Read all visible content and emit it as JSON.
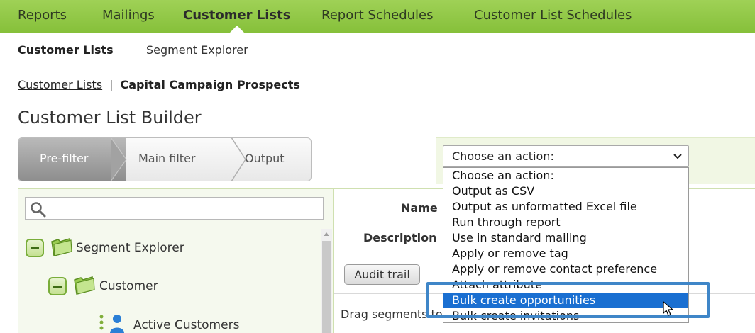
{
  "topnav": {
    "tabs": [
      {
        "label": "Reports"
      },
      {
        "label": "Mailings"
      },
      {
        "label": "Customer Lists"
      },
      {
        "label": "Report Schedules"
      },
      {
        "label": "Customer List Schedules"
      }
    ],
    "active_tab": "Customer Lists"
  },
  "subnav": {
    "items": [
      {
        "label": "Customer Lists"
      },
      {
        "label": "Segment Explorer"
      }
    ],
    "active_item": "Customer Lists"
  },
  "breadcrumb": {
    "link": "Customer Lists",
    "separator": "|",
    "current": "Capital Campaign Prospects"
  },
  "page_title": "Customer List Builder",
  "wizard": {
    "steps": [
      {
        "label": "Pre-filter",
        "active": true
      },
      {
        "label": "Main filter",
        "active": false
      },
      {
        "label": "Output",
        "active": false
      }
    ]
  },
  "action_select": {
    "value": "Choose an action:",
    "options": [
      "Choose an action:",
      "Output as CSV",
      "Output as unformatted Excel file",
      "Run through report",
      "Use in standard mailing",
      "Apply or remove tag",
      "Apply or remove contact preference",
      "Attach attribute",
      "Bulk create opportunities",
      "Bulk create invitations"
    ],
    "highlighted_option": "Bulk create opportunities"
  },
  "tree": {
    "search_placeholder": "",
    "nodes": [
      {
        "label": "Segment Explorer",
        "icon": "folder-icon"
      },
      {
        "label": "Customer",
        "icon": "folder-icon"
      },
      {
        "label": "Active Customers",
        "icon": "person-icon"
      }
    ]
  },
  "form": {
    "name_label": "Name",
    "description_label": "Description",
    "audit_button": "Audit trail",
    "drag_text": "Drag segments to"
  },
  "colors": {
    "nav_green": "#8fc647",
    "selection_blue": "#1a6fd1",
    "highlight_border": "#3f86c8"
  }
}
